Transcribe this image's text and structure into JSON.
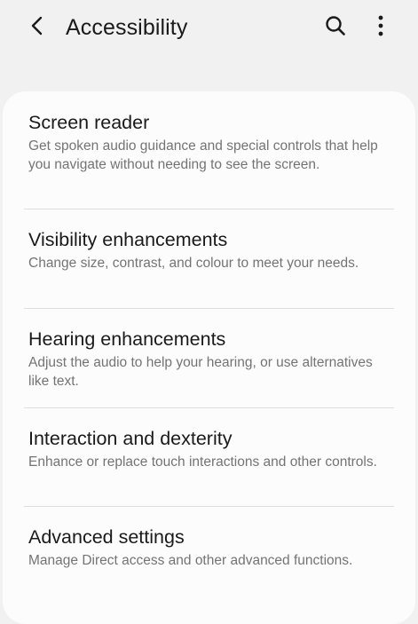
{
  "header": {
    "title": "Accessibility",
    "back_icon": "back-arrow-icon",
    "search_icon": "search-icon",
    "more_icon": "more-options-icon"
  },
  "menu": {
    "items": [
      {
        "title": "Screen reader",
        "description": "Get spoken audio guidance and special controls that help you navigate without needing to see the screen."
      },
      {
        "title": "Visibility enhancements",
        "description": "Change size, contrast, and colour to meet your needs."
      },
      {
        "title": "Hearing enhancements",
        "description": "Adjust the audio to help your hearing, or use alternatives like text."
      },
      {
        "title": "Interaction and dexterity",
        "description": "Enhance or replace touch interactions and other controls."
      },
      {
        "title": "Advanced settings",
        "description": "Manage Direct access and other advanced functions."
      }
    ]
  },
  "colors": {
    "background": "#f1f1f1",
    "card": "#fcfcfc",
    "title_text": "#1a1a1a",
    "secondary_text": "#747474",
    "divider": "#dedede"
  }
}
